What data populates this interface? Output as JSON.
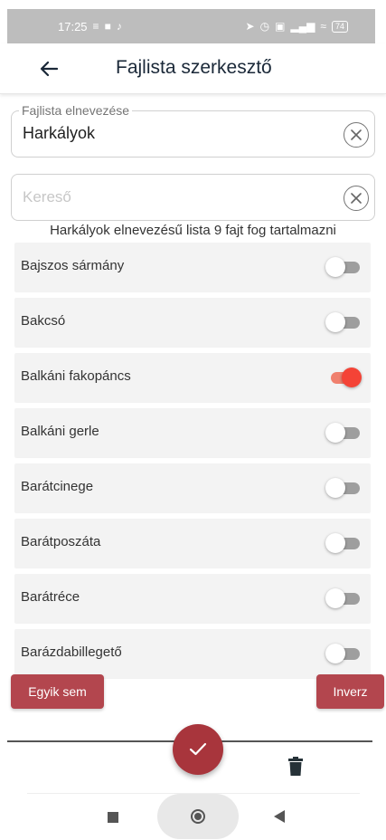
{
  "status_bar": {
    "time": "17:25",
    "left_icons": [
      "notification-icon",
      "car-icon",
      "tiktok-icon"
    ],
    "right_icons": [
      "location-icon",
      "alarm-icon",
      "sim-icon",
      "signal-icon",
      "wifi-icon"
    ],
    "battery": "74"
  },
  "app_bar": {
    "title": "Fajlista szerkesztő"
  },
  "name_field": {
    "label": "Fajlista elnevezése",
    "value": "Harkályok"
  },
  "search_field": {
    "placeholder": "Kereső",
    "value": ""
  },
  "info_text": "Harkályok elnevezésű lista 9 fajt fog tartalmazni",
  "species": [
    {
      "name": "Bajszos sármány",
      "selected": false
    },
    {
      "name": "Bakcsó",
      "selected": false
    },
    {
      "name": "Balkáni fakopáncs",
      "selected": true
    },
    {
      "name": "Balkáni gerle",
      "selected": false
    },
    {
      "name": "Barátcinege",
      "selected": false
    },
    {
      "name": "Barátposzáta",
      "selected": false
    },
    {
      "name": "Barátréce",
      "selected": false
    },
    {
      "name": "Barázdabillegető",
      "selected": false
    }
  ],
  "buttons": {
    "none": "Egyik sem",
    "inverse": "Inverz"
  },
  "colors": {
    "accent": "#b3464e",
    "fab": "#a8353c",
    "switch_on": "#f44336"
  }
}
